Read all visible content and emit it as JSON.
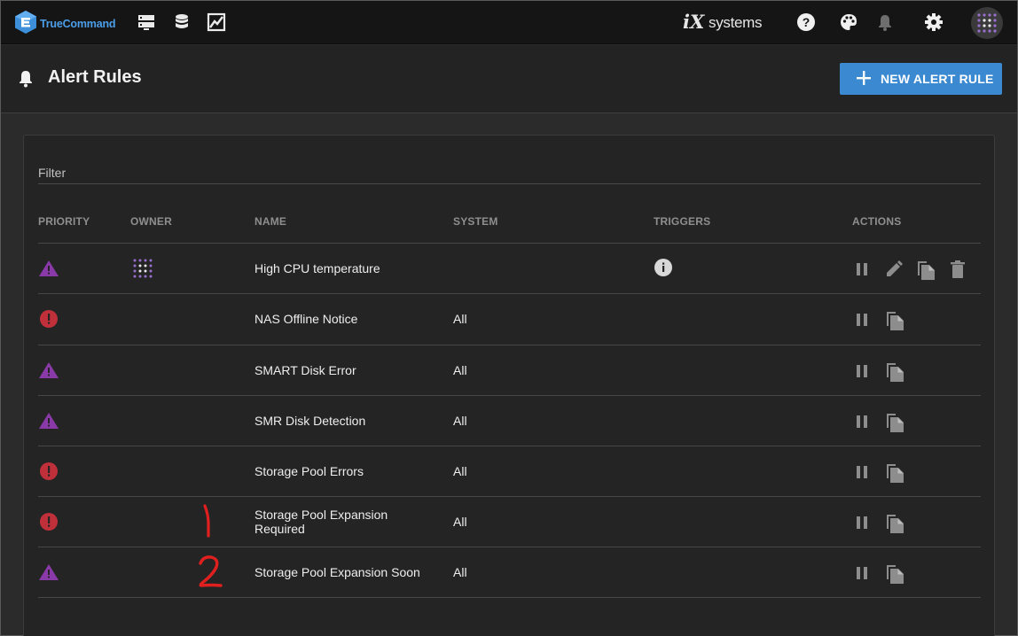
{
  "app": {
    "brand": "TrueCommand",
    "vendor_logo_mark": "iX",
    "vendor_logo_text": "systems"
  },
  "topbar": {
    "icons": [
      "servers-icon",
      "database-icon",
      "chart-icon",
      "help-icon",
      "palette-icon",
      "notifications-icon",
      "settings-icon",
      "user-avatar"
    ]
  },
  "page": {
    "title": "Alert Rules",
    "new_button_label": "NEW ALERT RULE"
  },
  "table": {
    "filter_label": "Filter",
    "columns": {
      "priority": "PRIORITY",
      "owner": "OWNER",
      "name": "NAME",
      "system": "SYSTEM",
      "triggers": "TRIGGERS",
      "actions": "ACTIONS"
    },
    "rows": [
      {
        "priority": "warning",
        "owner": "user-avatar",
        "name": "High CPU temperature",
        "system": "",
        "triggers": "info",
        "actions": [
          "pause",
          "edit",
          "copy",
          "delete"
        ]
      },
      {
        "priority": "critical",
        "owner": "",
        "name": "NAS Offline Notice",
        "system": "All",
        "triggers": "",
        "actions": [
          "pause",
          "copy"
        ]
      },
      {
        "priority": "warning",
        "owner": "",
        "name": "SMART Disk Error",
        "system": "All",
        "triggers": "",
        "actions": [
          "pause",
          "copy"
        ]
      },
      {
        "priority": "warning",
        "owner": "",
        "name": "SMR Disk Detection",
        "system": "All",
        "triggers": "",
        "actions": [
          "pause",
          "copy"
        ]
      },
      {
        "priority": "critical",
        "owner": "",
        "name": "Storage Pool Errors",
        "system": "All",
        "triggers": "",
        "actions": [
          "pause",
          "copy"
        ]
      },
      {
        "priority": "critical",
        "owner": "",
        "name": "Storage Pool Expansion Required",
        "system": "All",
        "triggers": "",
        "actions": [
          "pause",
          "copy"
        ]
      },
      {
        "priority": "warning",
        "owner": "",
        "name": "Storage Pool Expansion Soon",
        "system": "All",
        "triggers": "",
        "actions": [
          "pause",
          "copy"
        ]
      }
    ]
  },
  "annotations": [
    "1",
    "2"
  ],
  "colors": {
    "accent": "#3a89d1",
    "warning": "#8a3aa8",
    "critical": "#c0303a",
    "annotation": "#e0201f"
  }
}
